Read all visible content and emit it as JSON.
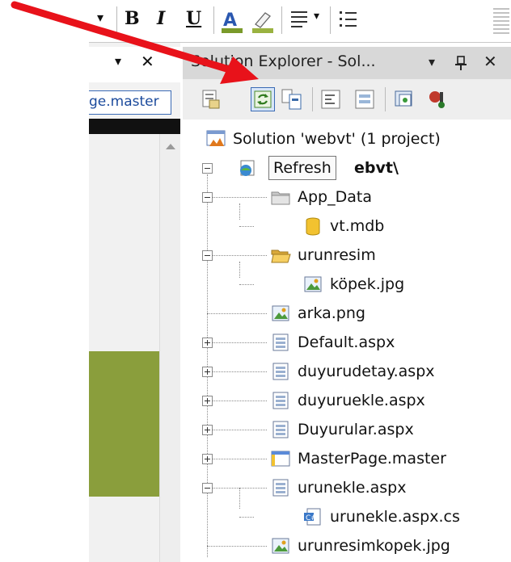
{
  "toolbar": {
    "bold_label": "B",
    "italic_label": "I",
    "underline_label": "U"
  },
  "left_panel": {
    "tab_label": "ge.master",
    "close_glyph": "✕",
    "dropdown_glyph": "▾"
  },
  "solution_explorer": {
    "title": "Solution Explorer - Sol...",
    "pin_glyph": "ꟸ",
    "close_glyph": "✕",
    "dropdown_glyph": "▾",
    "tooltip": "Refresh"
  },
  "tree": {
    "solution": "Solution 'webvt' (1 project)",
    "project_suffix": "ebvt\\",
    "items": [
      {
        "label": "App_Data",
        "icon": "folder-icon"
      },
      {
        "label": "vt.mdb",
        "icon": "database-icon"
      },
      {
        "label": "urunresim",
        "icon": "folder-open-icon"
      },
      {
        "label": "köpek.jpg",
        "icon": "image-icon"
      },
      {
        "label": "arka.png",
        "icon": "image-icon"
      },
      {
        "label": "Default.aspx",
        "icon": "webform-icon"
      },
      {
        "label": "duyurudetay.aspx",
        "icon": "webform-icon"
      },
      {
        "label": "duyuruekle.aspx",
        "icon": "webform-icon"
      },
      {
        "label": "Duyurular.aspx",
        "icon": "webform-icon"
      },
      {
        "label": "MasterPage.master",
        "icon": "masterpage-icon"
      },
      {
        "label": "urunekle.aspx",
        "icon": "webform-icon"
      },
      {
        "label": "urunekle.aspx.cs",
        "icon": "csharp-file-icon"
      },
      {
        "label": "urunresimkopek.jpg",
        "icon": "image-icon"
      }
    ]
  },
  "colors": {
    "annotation_arrow": "#e8121a",
    "olive_block": "#8a9e3c",
    "selection_border": "#3b6bb5"
  }
}
